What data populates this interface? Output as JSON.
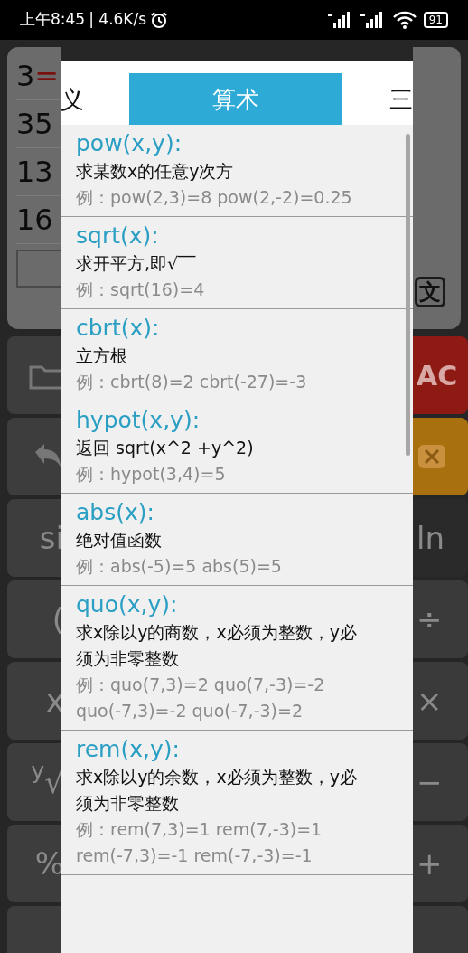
{
  "status_bar": {
    "time": "上午8:45",
    "speed": "| 4.6K/s",
    "battery": "91"
  },
  "display": {
    "rows": [
      {
        "value": "3",
        "operator": "="
      },
      {
        "value": "35"
      },
      {
        "value": "13"
      },
      {
        "value": "16"
      }
    ],
    "mode_key": "文"
  },
  "left_keys": [
    {
      "kind": "folder"
    },
    {
      "kind": "undo"
    },
    {
      "kind": "text",
      "label": "si"
    },
    {
      "kind": "text",
      "label": "("
    },
    {
      "kind": "text",
      "label": "x"
    },
    {
      "kind": "text",
      "label": "$^{y}$√"
    },
    {
      "kind": "text",
      "label": "%"
    },
    {
      "kind": "blank"
    }
  ],
  "right_keys": [
    {
      "kind": "text",
      "label": "AC",
      "color": "#8e1a14"
    },
    {
      "kind": "backspace",
      "color": "#a8700f"
    },
    {
      "kind": "text",
      "label": "ln",
      "color": "#2a2a2a"
    },
    {
      "kind": "text",
      "label": "÷",
      "color": "#3a3a3a"
    },
    {
      "kind": "text",
      "label": "×",
      "color": "#3a3a3a"
    },
    {
      "kind": "text",
      "label": "−",
      "color": "#3a3a3a"
    },
    {
      "kind": "text",
      "label": "+",
      "color": "#3a3a3a"
    },
    {
      "kind": "blank",
      "color": "#3a3a3a"
    }
  ],
  "dialog": {
    "tabs": [
      {
        "label": "义",
        "selected": false
      },
      {
        "label": "算术",
        "selected": true
      },
      {
        "label": "三",
        "selected": false
      }
    ],
    "functions": [
      {
        "name": "pow(x,y):",
        "description": "求某数x的任意y次方",
        "example": "例：pow(2,3)=8 pow(2,-2)=0.25"
      },
      {
        "name": "sqrt(x):",
        "description": "求开平方,即√‾‾",
        "example": "例：sqrt(16)=4"
      },
      {
        "name": "cbrt(x):",
        "description": "立方根",
        "example": "例：cbrt(8)=2 cbrt(-27)=-3"
      },
      {
        "name": "hypot(x,y):",
        "description": "返回 sqrt(x^2 +y^2)",
        "example": "例：hypot(3,4)=5"
      },
      {
        "name": "abs(x):",
        "description": "绝对值函数",
        "example": "例：abs(-5)=5 abs(5)=5"
      },
      {
        "name": "quo(x,y):",
        "description": "求x除以y的商数，x必须为整数，y必须为非零整数",
        "example": "例：quo(7,3)=2 quo(7,-3)=-2 quo(-7,3)=-2 quo(-7,-3)=2"
      },
      {
        "name": "rem(x,y):",
        "description": "求x除以y的余数，x必须为整数，y必须为非零整数",
        "example": "例：rem(7,3)=1 rem(7,-3)=1 rem(-7,3)=-1 rem(-7,-3)=-1"
      }
    ]
  }
}
